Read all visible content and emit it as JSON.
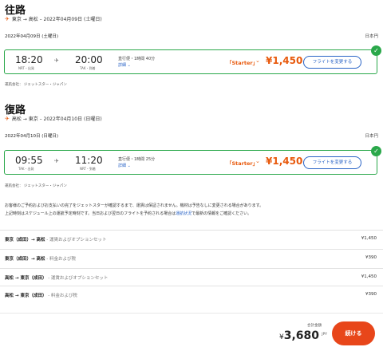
{
  "outbound": {
    "title": "往路",
    "route": "東京 → 高松 – 2022年04月09日 (土曜日)",
    "date": "2022年04月09日 (土曜日)",
    "currency": "日本円",
    "depart_time": "18:20",
    "depart_airport": "NRT・出発",
    "arrive_time": "20:00",
    "arrive_airport": "TAK・到着",
    "stops": "直行便・1時間 40分",
    "details": "詳細 ⌄",
    "fare": "「Starter」",
    "price": "¥1,450",
    "change_button": "フライトを変更する",
    "carrier": "運航会社：  ジェットスター・ジャパン"
  },
  "return": {
    "title": "復路",
    "route": "高松 → 東京 – 2022年04月10日 (日曜日)",
    "date": "2022年04月10日 (日曜日)",
    "currency": "日本円",
    "depart_time": "09:55",
    "depart_airport": "TAK・出発",
    "arrive_time": "11:20",
    "arrive_airport": "NRT・到着",
    "stops": "直行便・1時間 25分",
    "details": "詳細 ⌄",
    "fare": "「Starter」",
    "price": "¥1,450",
    "change_button": "フライトを変更する",
    "carrier": "運航会社：  ジェットスター・ジャパン"
  },
  "notice": {
    "line1": "お客様のご予約およびお支払いの完了をジェットスターが確認するまで、運賃は保証されません。機材は予告なしに変更される場合があります。",
    "line2_pre": "上記時刻はスケジュール上の運航予定時刻です。当日および翌日のフライトを予約される場合は",
    "line2_link": "運航状況",
    "line2_post": "で最新の情報をご確認ください。"
  },
  "price_rows": [
    {
      "route": "東京（成田）→ 高松",
      "desc": " - 運賃およびオプションセット",
      "amount": "¥1,450"
    },
    {
      "route": "東京（成田）→ 高松",
      "desc": " - 料金および税",
      "amount": "¥390"
    },
    {
      "route": "高松 → 東京（成田）",
      "desc": " - 運賃およびオプションセット",
      "amount": "¥1,450"
    },
    {
      "route": "高松 → 東京（成田）",
      "desc": " - 料金および税",
      "amount": "¥390"
    }
  ],
  "footer": {
    "total_label": "合計金額",
    "total_yen": "¥",
    "total_amount": "3,680",
    "total_currency": "JPY",
    "continue_button": "続ける"
  },
  "colors": {
    "accent": "#e8590c",
    "selected_border": "#2aa84a",
    "link": "#2a64c6",
    "continue": "#e8461a"
  }
}
